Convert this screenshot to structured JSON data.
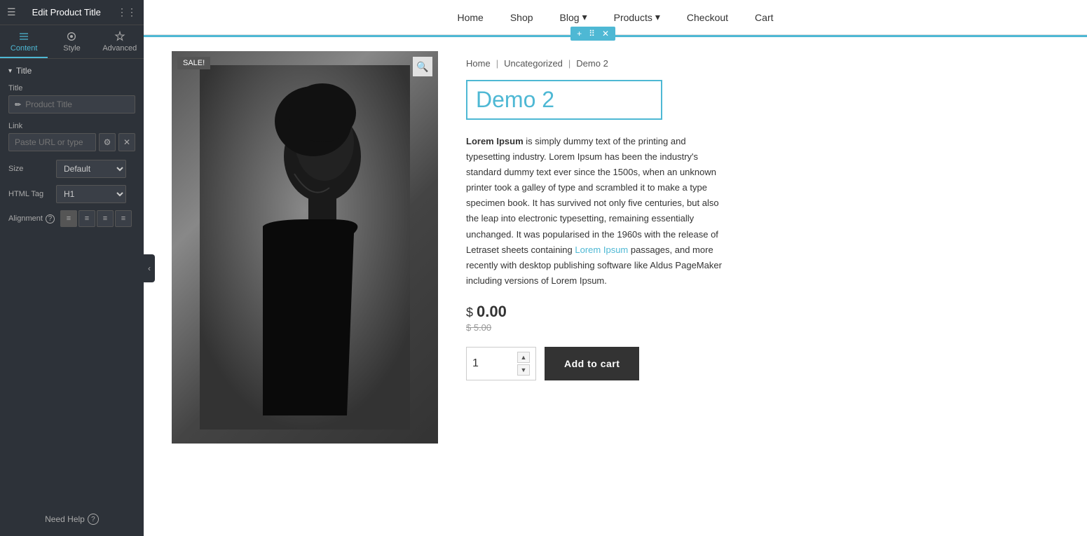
{
  "sidebar": {
    "header": {
      "title": "Edit Product Title",
      "hamburger": "☰",
      "grid": "⋮⋮⋮"
    },
    "tabs": [
      {
        "label": "Content",
        "active": true
      },
      {
        "label": "Style",
        "active": false
      },
      {
        "label": "Advanced",
        "active": false
      }
    ],
    "section": {
      "title": "Title",
      "arrow": "▾"
    },
    "fields": {
      "title_label": "Title",
      "title_placeholder": "Product Title",
      "link_label": "Link",
      "link_placeholder": "Paste URL or type",
      "size_label": "Size",
      "size_default": "Default",
      "html_tag_label": "HTML Tag",
      "html_tag_default": "H1",
      "alignment_label": "Alignment"
    },
    "need_help": "Need Help"
  },
  "nav": {
    "items": [
      {
        "label": "Home"
      },
      {
        "label": "Shop"
      },
      {
        "label": "Blog",
        "has_dropdown": true
      },
      {
        "label": "Products",
        "has_dropdown": true
      },
      {
        "label": "Checkout"
      },
      {
        "label": "Cart"
      }
    ]
  },
  "product": {
    "breadcrumb": {
      "home": "Home",
      "category": "Uncategorized",
      "current": "Demo 2"
    },
    "title": "Demo 2",
    "sale_badge": "SALE!",
    "description": "Lorem Ipsum is simply dummy text of the printing and typesetting industry. Lorem Ipsum has been the industry's standard dummy text ever since the 1500s, when an unknown printer took a galley of type and scrambled it to make a type specimen book. It has survived not only five centuries, but also the leap into electronic typesetting, remaining essentially unchanged. It was popularised in the 1960s with the release of Letraset sheets containing Lorem Ipsum passages, and more recently with desktop publishing software like Aldus PageMaker including versions of Lorem Ipsum.",
    "current_price": "$ 0.00",
    "dollar": "$",
    "price_value": "0.00",
    "old_price": "$ 5.00",
    "qty": "1",
    "add_to_cart_label": "Add to cart"
  },
  "colors": {
    "accent": "#4eb8d4",
    "sidebar_bg": "#2d3239",
    "dark": "#333"
  }
}
